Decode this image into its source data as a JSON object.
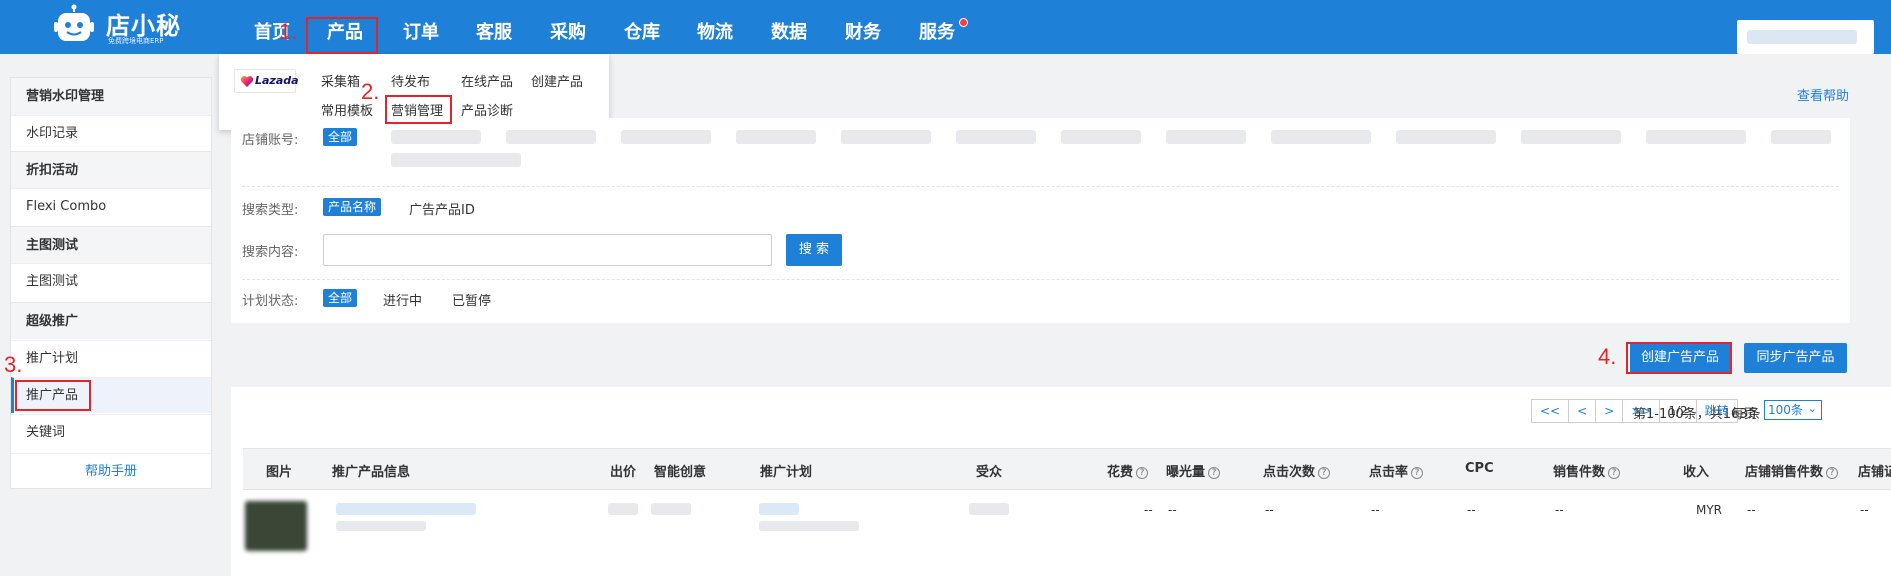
{
  "brand": {
    "name": "店小秘",
    "tagline": "免费跨境电商ERP"
  },
  "nav": {
    "items": [
      "首页",
      "产品",
      "订单",
      "客服",
      "采购",
      "仓库",
      "物流",
      "数据",
      "财务",
      "服务"
    ]
  },
  "annotations": [
    "1.",
    "2.",
    "3.",
    "4."
  ],
  "dropdown": {
    "platform": "Lazada",
    "links": [
      "采集箱",
      "待发布",
      "在线产品",
      "创建产品",
      "常用模板",
      "营销管理",
      "产品诊断"
    ]
  },
  "sidebar": {
    "sections": [
      {
        "title": "营销水印管理",
        "items": [
          "水印记录"
        ]
      },
      {
        "title": "折扣活动",
        "items": [
          "Flexi Combo"
        ]
      },
      {
        "title": "主图测试",
        "items": [
          "主图测试"
        ]
      },
      {
        "title": "超级推广",
        "items": [
          "推广计划",
          "推广产品",
          "关键词"
        ]
      }
    ],
    "help": "帮助手册"
  },
  "help_link": "查看帮助",
  "filters": {
    "shop_label": "店铺账号:",
    "shop_all": "全部",
    "search_type_label": "搜索类型:",
    "search_type_options": [
      "产品名称",
      "广告产品ID"
    ],
    "search_content_label": "搜索内容:",
    "search_button": "搜 索",
    "status_label": "计划状态:",
    "status_options": [
      "全部",
      "进行中",
      "已暂停"
    ]
  },
  "actions": {
    "create": "创建广告产品",
    "sync": "同步广告产品"
  },
  "pagination": {
    "info": "第1-100条，共163条",
    "buttons": [
      "<<",
      "<",
      ">",
      ">>",
      "1/2",
      "跳转"
    ],
    "per_page_label": "每页",
    "per_page_value": "100条"
  },
  "table": {
    "headers": [
      "图片",
      "推广产品信息",
      "出价",
      "智能创意",
      "推广计划",
      "受众",
      "花费",
      "曝光量",
      "点击次数",
      "点击率",
      "CPC",
      "销售件数",
      "收入",
      "店铺销售件数",
      "店铺证"
    ],
    "help_headers": [
      "花费",
      "曝光量",
      "点击次数",
      "点击率",
      "销售件数",
      "店铺销售件数"
    ],
    "row": {
      "cells": [
        "--",
        "--",
        "--",
        "--",
        "--",
        "--",
        "MYR",
        "--",
        "--"
      ]
    }
  },
  "colors": {
    "primary": "#1f80d7",
    "annotation": "#e2252b"
  }
}
